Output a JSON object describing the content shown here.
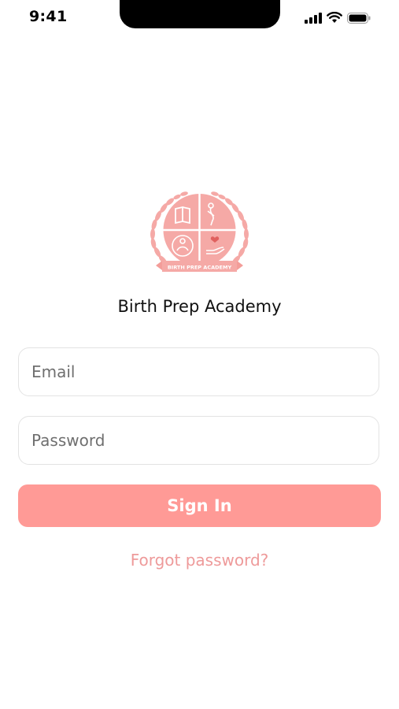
{
  "status_bar": {
    "time": "9:41"
  },
  "logo": {
    "banner_text": "BIRTH PREP ACADEMY",
    "color": "#f5a9a6"
  },
  "app": {
    "name": "Birth Prep Academy"
  },
  "form": {
    "email_placeholder": "Email",
    "password_placeholder": "Password",
    "signin_label": "Sign In",
    "forgot_label": "Forgot password?"
  },
  "colors": {
    "accent": "#ff9a96",
    "link": "#ee9a9a",
    "border": "#e3e3e3"
  }
}
